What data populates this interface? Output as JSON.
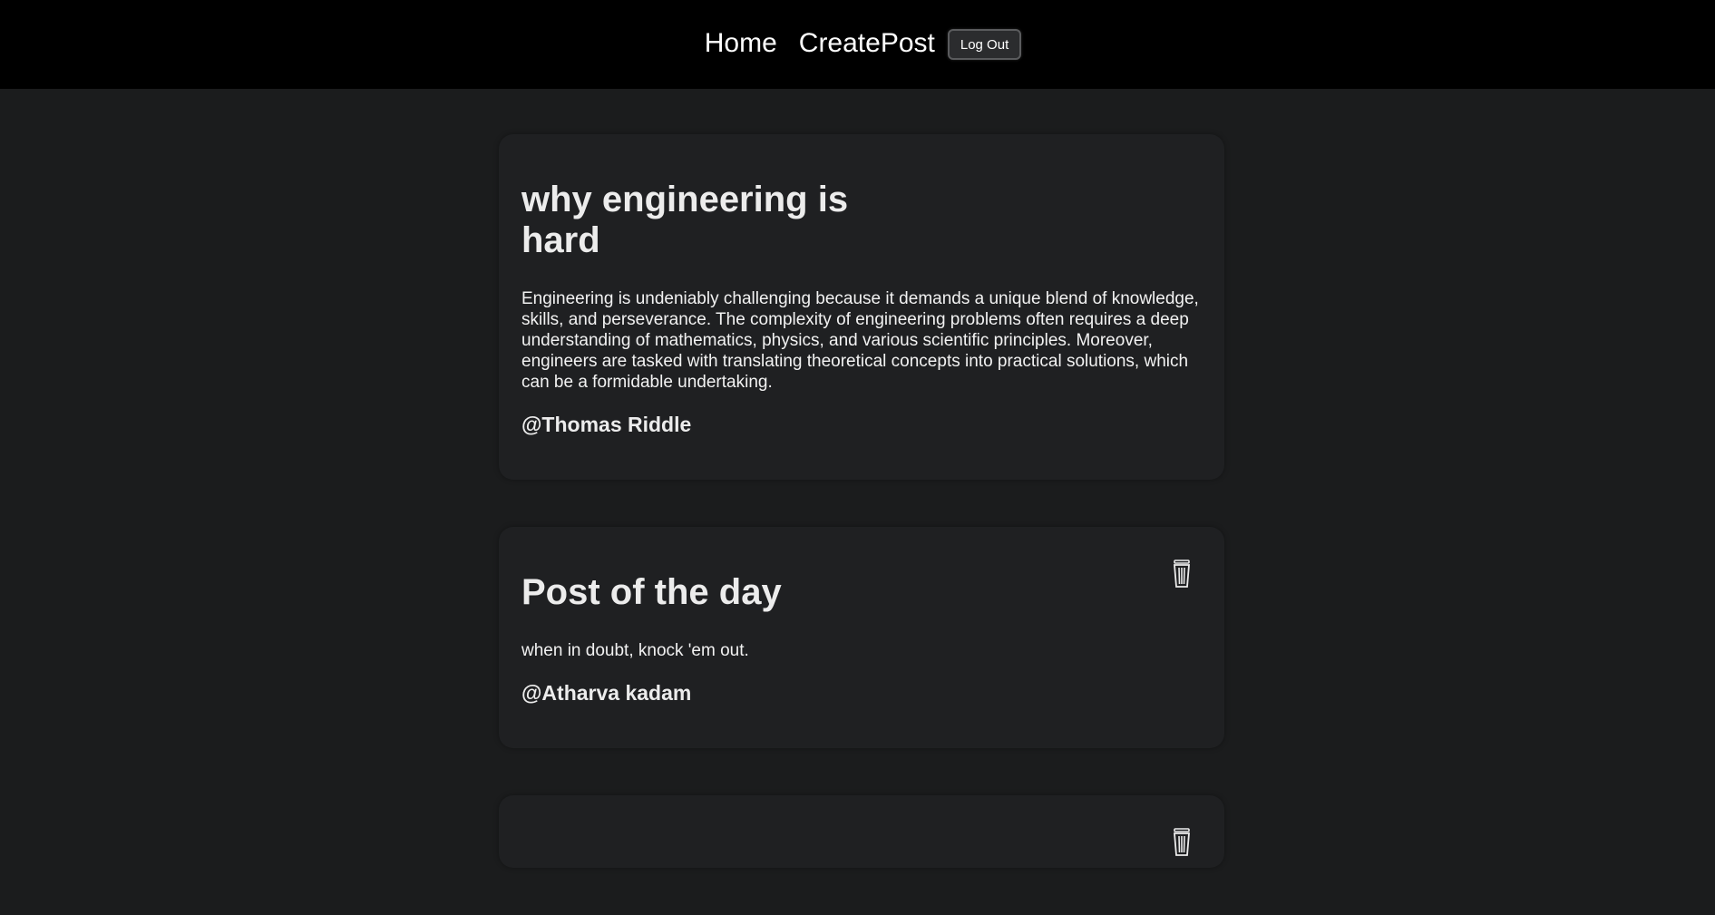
{
  "nav": {
    "home_label": "Home",
    "create_label": "CreatePost",
    "logout_label": "Log Out"
  },
  "posts": [
    {
      "title": "why engineering is hard",
      "body": "Engineering is undeniably challenging because it demands a unique blend of knowledge, skills, and perseverance. The complexity of engineering problems often requires a deep understanding of mathematics, physics, and various scientific principles. Moreover, engineers are tasked with translating theoretical concepts into practical solutions, which can be a formidable undertaking.",
      "author": "@Thomas Riddle",
      "has_delete": false
    },
    {
      "title": "Post of the day",
      "body": "when in doubt, knock 'em out.",
      "author": "@Atharva kadam",
      "has_delete": true
    },
    {
      "has_delete": true
    }
  ],
  "icons": {
    "delete": "trash-can-icon"
  },
  "colors": {
    "page_bg": "#1b1c1d",
    "navbar_bg": "#000000",
    "card_bg": "#1f2022",
    "text": "#ececec"
  }
}
